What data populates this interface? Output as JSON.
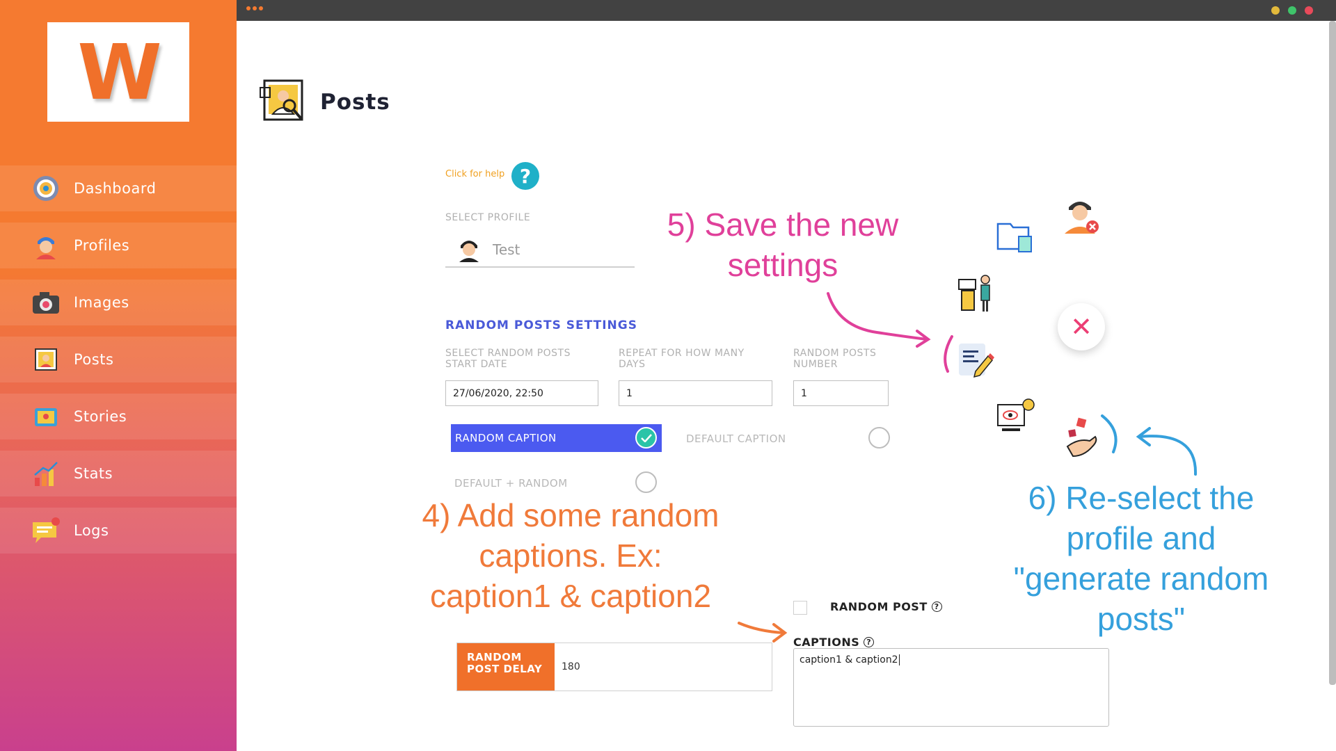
{
  "app": {
    "logo_letter": "W",
    "colors": {
      "accent": "#f0702a",
      "sidebar_bottom": "#c9408d",
      "primary_blue": "#4b5af0",
      "help_teal": "#1fb0c8",
      "close_pink": "#ec3e74"
    }
  },
  "sidebar": {
    "items": [
      {
        "label": "Dashboard",
        "icon": "dashboard-gauge-icon"
      },
      {
        "label": "Profiles",
        "icon": "profile-avatar-icon"
      },
      {
        "label": "Images",
        "icon": "camera-icon"
      },
      {
        "label": "Posts",
        "icon": "posts-photo-icon"
      },
      {
        "label": "Stories",
        "icon": "stories-icon"
      },
      {
        "label": "Stats",
        "icon": "stats-chart-icon"
      },
      {
        "label": "Logs",
        "icon": "logs-message-icon"
      }
    ]
  },
  "header": {
    "title": "Posts",
    "icon": "posts-photo-icon"
  },
  "help": {
    "link_text": "Click for help",
    "button_glyph": "?"
  },
  "profile": {
    "label": "SELECT PROFILE",
    "value": "Test"
  },
  "random_settings": {
    "title": "RANDOM POSTS SETTINGS",
    "start_date_label_line1": "SELECT RANDOM POSTS",
    "start_date_label_line2": "START DATE",
    "start_date_value": "27/06/2020, 22:50",
    "repeat_label_line1": "REPEAT FOR HOW MANY",
    "repeat_label_line2": "DAYS",
    "repeat_value": "1",
    "number_label_line1": "RANDOM POSTS",
    "number_label_line2": "NUMBER",
    "number_value": "1"
  },
  "caption_options": {
    "random": {
      "label": "RANDOM CAPTION",
      "selected": true
    },
    "default": {
      "label": "DEFAULT CAPTION",
      "selected": false
    },
    "default_random": {
      "label": "DEFAULT + RANDOM",
      "selected": false
    }
  },
  "random_post": {
    "label": "RANDOM POST",
    "checked": false
  },
  "captions": {
    "label": "CAPTIONS",
    "value": "caption1 & caption2"
  },
  "delay": {
    "label_line1": "RANDOM",
    "label_line2": "POST DELAY",
    "value": "180"
  },
  "annotations": {
    "step4_line1": "4) Add some random",
    "step4_line2": "captions. Ex:",
    "step4_line3": "caption1 & caption2",
    "step5_line1": "5) Save the new",
    "step5_line2": "settings",
    "step6_line1": "6) Re-select the",
    "step6_line2": "profile and",
    "step6_line3": "\"generate random",
    "step6_line4": "posts\""
  },
  "fab": {
    "close_glyph": "✕"
  }
}
